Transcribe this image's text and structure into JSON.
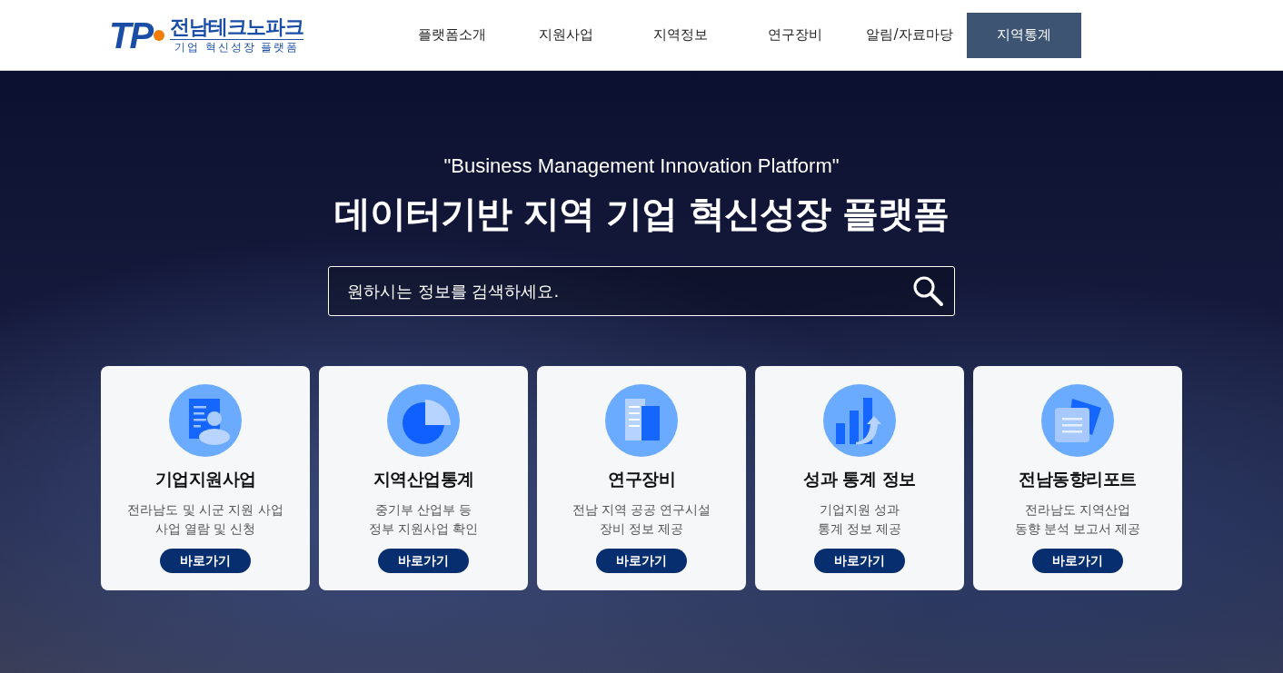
{
  "header": {
    "logo": {
      "mark": "TP",
      "name": "전남테크노파크",
      "tagline": "기업 혁신성장 플랫폼"
    },
    "nav": [
      {
        "label": "플랫폼소개",
        "selected": false
      },
      {
        "label": "지원사업",
        "selected": false
      },
      {
        "label": "지역정보",
        "selected": false
      },
      {
        "label": "연구장비",
        "selected": false
      },
      {
        "label": "알림/자료마당",
        "selected": false
      },
      {
        "label": "지역통계",
        "selected": true
      }
    ]
  },
  "hero": {
    "subtitle": "\"Business Management Innovation Platform\"",
    "title": "데이터기반 지역 기업 혁신성장 플랫폼",
    "search": {
      "placeholder": "원하시는 정보를 검색하세요."
    },
    "cards": [
      {
        "kind": "profile",
        "title": "기업지원사업",
        "lines": [
          "전라남도 및 시군 지원 사업",
          "사업 열람 및 신청"
        ],
        "button": "바로가기"
      },
      {
        "kind": "pie",
        "title": "지역산업통계",
        "lines": [
          "중기부 산업부 등",
          "정부 지원사업 확인"
        ],
        "button": "바로가기"
      },
      {
        "kind": "building",
        "title": "연구장비",
        "lines": [
          "전남 지역 공공 연구시설",
          "장비 정보 제공"
        ],
        "button": "바로가기"
      },
      {
        "kind": "bars",
        "title": "성과 통계 정보",
        "lines": [
          "기업지원 성과",
          "통계 정보 제공"
        ],
        "button": "바로가기"
      },
      {
        "kind": "papers",
        "title": "전남동향리포트",
        "lines": [
          "전라남도 지역산업",
          "동향 분석 보고서 제공"
        ],
        "button": "바로가기"
      }
    ]
  }
}
